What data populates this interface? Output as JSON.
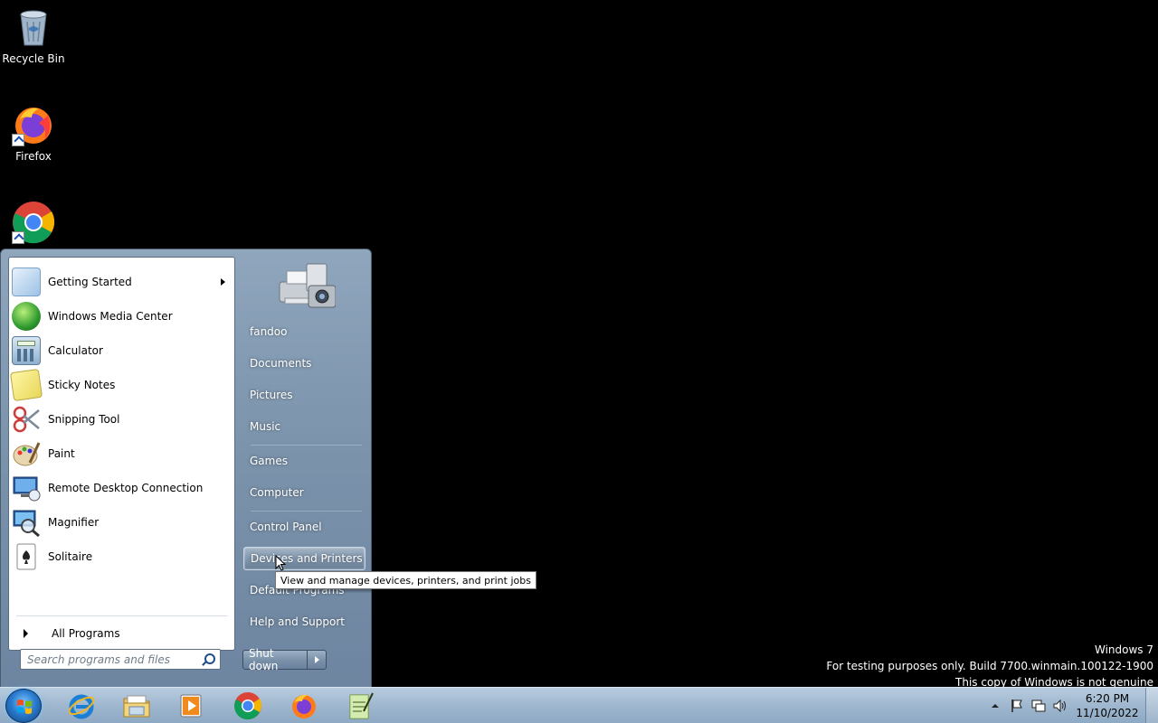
{
  "desktop": {
    "icons": [
      {
        "label": "Recycle Bin",
        "icon": "recycle-bin-icon"
      },
      {
        "label": "Firefox",
        "icon": "firefox-icon"
      },
      {
        "label": "",
        "icon": "chrome-icon"
      }
    ]
  },
  "start_menu": {
    "programs": [
      {
        "label": "Getting Started",
        "icon": "getting-started-icon",
        "has_submenu": true
      },
      {
        "label": "Windows Media Center",
        "icon": "media-center-icon"
      },
      {
        "label": "Calculator",
        "icon": "calculator-icon"
      },
      {
        "label": "Sticky Notes",
        "icon": "sticky-notes-icon"
      },
      {
        "label": "Snipping Tool",
        "icon": "snipping-tool-icon"
      },
      {
        "label": "Paint",
        "icon": "paint-icon"
      },
      {
        "label": "Remote Desktop Connection",
        "icon": "remote-desktop-icon"
      },
      {
        "label": "Magnifier",
        "icon": "magnifier-icon"
      },
      {
        "label": "Solitaire",
        "icon": "solitaire-icon"
      }
    ],
    "all_programs": "All Programs",
    "search_placeholder": "Search programs and files",
    "right_items": [
      {
        "label": "fandoo"
      },
      {
        "label": "Documents"
      },
      {
        "label": "Pictures"
      },
      {
        "label": "Music"
      },
      {
        "label": "Games"
      },
      {
        "label": "Computer"
      },
      {
        "label": "Control Panel"
      },
      {
        "label": "Devices and Printers"
      },
      {
        "label": "Default Programs"
      },
      {
        "label": "Help and Support"
      }
    ],
    "shutdown_label": "Shut down",
    "tooltip": "View and manage devices, printers, and print jobs"
  },
  "watermark": {
    "line1": "Windows 7",
    "line2": "For testing purposes only. Build 7700.winmain.100122-1900",
    "line3": "This copy of Windows is not genuine"
  },
  "taskbar": {
    "pinned": [
      "internet-explorer-icon",
      "windows-explorer-icon",
      "media-player-icon",
      "chrome-icon",
      "firefox-icon",
      "notepad-icon"
    ],
    "clock_time": "6:20 PM",
    "clock_date": "11/10/2022"
  }
}
